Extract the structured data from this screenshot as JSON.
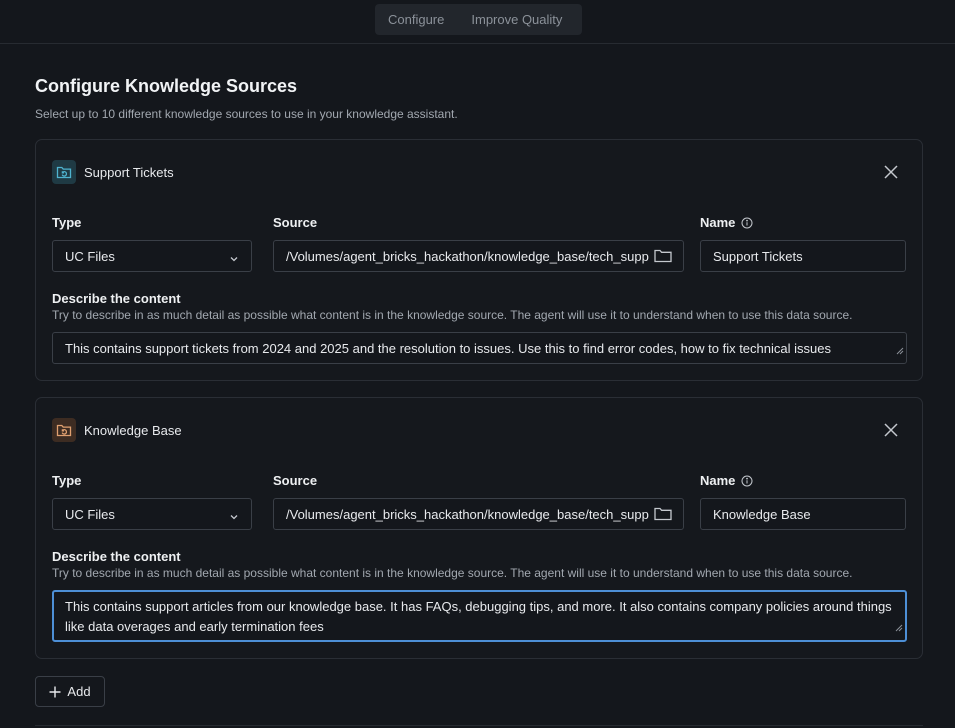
{
  "tabs": {
    "configure": "Configure",
    "improve": "Improve Quality"
  },
  "page": {
    "title": "Configure Knowledge Sources",
    "subtitle": "Select up to 10 different knowledge sources to use in your knowledge assistant."
  },
  "labels": {
    "type": "Type",
    "source": "Source",
    "name": "Name",
    "describe": "Describe the content",
    "describe_hint": "Try to describe in as much detail as possible what content is in the knowledge source. The agent will use it to understand when to use this data source."
  },
  "sources": [
    {
      "title": "Support Tickets",
      "icon": "folder-refresh-icon",
      "icon_color": "#4fb3cf",
      "type": "UC Files",
      "source": "/Volumes/agent_bricks_hackathon/knowledge_base/tech_support_tickets",
      "name": "Support Tickets",
      "description": "This contains support tickets from 2024 and 2025 and the resolution to issues. Use this to find error codes, how to fix technical issues"
    },
    {
      "title": "Knowledge Base",
      "icon": "folder-refresh-icon",
      "icon_color": "#e0a070",
      "type": "UC Files",
      "source": "/Volumes/agent_bricks_hackathon/knowledge_base/tech_support_articles",
      "name": "Knowledge Base",
      "description": "This contains support articles from our knowledge base. It has FAQs, debugging tips, and more. It also contains company policies around things like data overages and early termination fees"
    }
  ],
  "add_label": "Add"
}
